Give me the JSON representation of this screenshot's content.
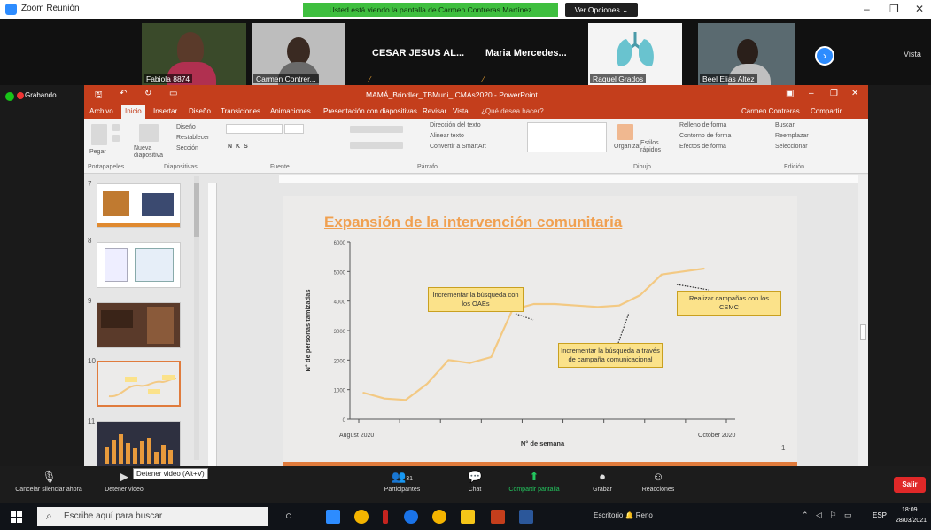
{
  "zoom": {
    "title": "Zoom Reunión",
    "share_banner": "Usted está viendo la pantalla de Carmen Contreras Martínez",
    "view_options": "Ver Opciones ⌄",
    "view_button": "Vista",
    "recording_label": "Grabando..."
  },
  "participants": [
    {
      "name": "Fabiola 8874"
    },
    {
      "name": "Carmen Contrer..."
    },
    {
      "name": "CESAR JESUS AL..."
    },
    {
      "name": "Maria  Mercedes..."
    },
    {
      "name": "Raquel Grados"
    },
    {
      "name": "Beel Elias Altez"
    }
  ],
  "ppt": {
    "title": "MAMÁ_Brindler_TBMuni_ICMAs2020 - PowerPoint",
    "tabs": [
      "Archivo",
      "Inicio",
      "Insertar",
      "Diseño",
      "Transiciones",
      "Animaciones",
      "Presentación con diapositivas",
      "Revisar",
      "Vista",
      "¿Qué desea hacer?"
    ],
    "user": "Carmen Contreras",
    "share": "Compartir",
    "ribbon": {
      "groups": [
        "Portapapeles",
        "Diapositivas",
        "Fuente",
        "Párrafo",
        "Dibujo",
        "Edición"
      ],
      "paste": "Pegar",
      "new_slide": "Nueva diapositiva",
      "design": "Diseño",
      "reset": "Restablecer",
      "section": "Sección",
      "text_direction": "Dirección del texto",
      "align_text": "Alinear texto",
      "convert_smartart": "Convertir a SmartArt",
      "arrange": "Organizar",
      "quick_styles": "Estilos rápidos",
      "shape_fill": "Relleno de forma",
      "shape_outline": "Contorno de forma",
      "shape_effects": "Efectos de forma",
      "find": "Buscar",
      "replace": "Reemplazar",
      "select": "Seleccionar"
    },
    "thumb_numbers": [
      "7",
      "8",
      "9",
      "10",
      "11"
    ]
  },
  "slide": {
    "title": "Expansión de la intervención comunitaria",
    "callouts": [
      "Incrementar la búsqueda con los OAEs",
      "Incrementar la búsqueda a través de campaña comunicacional",
      "Realizar campañas con los CSMC"
    ],
    "page_number": "1"
  },
  "chart_data": {
    "type": "line",
    "title": "",
    "xlabel": "N° de semana",
    "ylabel": "N° de personas tamizadas",
    "x_start_label": "August 2020",
    "x_end_label": "October 2020",
    "y_ticks": [
      "0",
      "1000",
      "2000",
      "3000",
      "4000",
      "5000",
      "6000"
    ],
    "ylim": [
      0,
      6000
    ],
    "x": [
      1,
      2,
      3,
      4,
      5,
      6,
      7,
      8,
      9,
      10,
      11,
      12,
      13,
      14,
      15,
      16,
      17,
      18,
      19,
      20
    ],
    "values": [
      900,
      700,
      650,
      1200,
      2000,
      1900,
      2100,
      3700,
      3900,
      3900,
      3850,
      3800,
      3850,
      4200,
      4900,
      5000,
      5100
    ],
    "series_color": "#f3c983"
  },
  "controls": {
    "mute": "Cancelar silenciar ahora",
    "video": "Detener video",
    "participants": "Participantes",
    "participants_count": "31",
    "chat": "Chat",
    "share": "Compartir pantalla",
    "record": "Grabar",
    "reactions": "Reacciones",
    "leave": "Salir",
    "tooltip": "Detener video (Alt+V)"
  },
  "taskbar": {
    "search_placeholder": "Escribe aquí para buscar",
    "tray_text": "Escritorio  🔔 Reno",
    "lang": "ESP",
    "time": "18:09",
    "date": "28/03/2021"
  }
}
